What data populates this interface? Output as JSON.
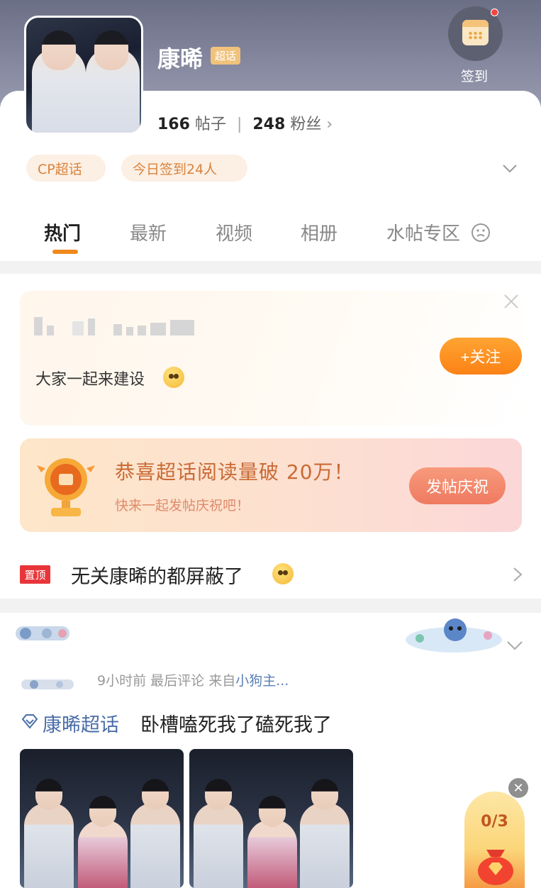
{
  "header": {
    "title": "康晞",
    "super_tag": "超话",
    "checkin_label": "签到",
    "stats": {
      "posts_count": "166",
      "posts_label": "帖子",
      "fans_count": "248",
      "fans_label": "粉丝"
    },
    "chips": [
      "CP超话",
      "今日签到24人"
    ]
  },
  "tabs": [
    "热门",
    "最新",
    "视频",
    "相册",
    "水帖专区"
  ],
  "active_tab": "热门",
  "promo_card": {
    "message": "大家一起来建设",
    "follow_label": "+关注"
  },
  "milestone_card": {
    "title": "恭喜超话阅读量破 20万！",
    "subtitle": "快来一起发帖庆祝吧！",
    "button_label": "发帖庆祝"
  },
  "pinned": {
    "tag": "置顶",
    "text": "无关康晞的都屏蔽了"
  },
  "post": {
    "meta_time": "9小时前",
    "meta_action": "最后评论",
    "meta_from": "来自",
    "meta_source": "小狗主...",
    "topic": "康晞超话",
    "text": "卧槽嗑死我了磕死我了"
  },
  "reward_widget": {
    "progress": "0/3"
  },
  "colors": {
    "accent_orange": "#ee8a1b",
    "link_blue": "#4a6ea8",
    "pinned_red": "#e8353a"
  }
}
